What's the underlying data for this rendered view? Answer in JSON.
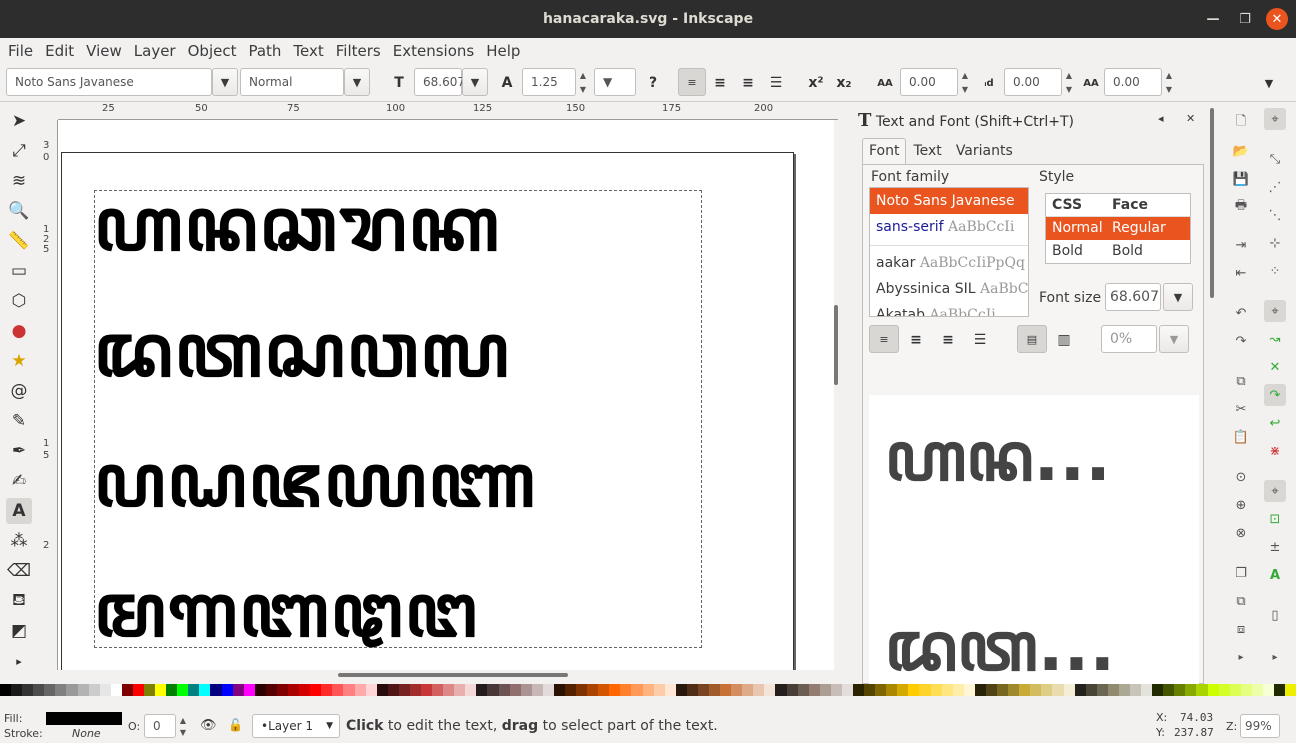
{
  "window": {
    "title": "hanacaraka.svg - Inkscape"
  },
  "menu": [
    "File",
    "Edit",
    "View",
    "Layer",
    "Object",
    "Path",
    "Text",
    "Filters",
    "Extensions",
    "Help"
  ],
  "toolbar": {
    "font_family": "Noto Sans Javanese",
    "font_style": "Normal",
    "font_size": "68.607",
    "line_spacing": "1.25",
    "letter_spacing": "0.00",
    "word_spacing": "0.00",
    "kerning": "0.00",
    "help": "?"
  },
  "ruler": {
    "top_ticks": [
      "25",
      "50",
      "75",
      "100",
      "125",
      "150",
      "175",
      "200"
    ],
    "left_ticks": [
      "3",
      "0",
      "1",
      "2",
      "5",
      "1",
      "5",
      "2"
    ]
  },
  "canvas": {
    "lines": [
      "ꦲꦤꦕꦫꦏ",
      "ꦢꦠꦱꦮꦭ",
      "ꦥꦝꦗꦪꦚ",
      "ꦩꦒꦧꦛꦔ"
    ]
  },
  "dock": {
    "title": "Text and Font (Shift+Ctrl+T)",
    "tabs": [
      "Font",
      "Text",
      "Variants"
    ],
    "font_family_label": "Font family",
    "families": [
      {
        "name": "Noto Sans Javanese",
        "sample": ""
      },
      {
        "name": "sans-serif",
        "sample": "AaBbCcIi"
      },
      {
        "name": "aakar",
        "sample": "AaBbCcIiPpQq"
      },
      {
        "name": "Abyssinica SIL",
        "sample": "AaBbC"
      },
      {
        "name": "Akatab",
        "sample": "AaBbCcIi"
      }
    ],
    "style_label": "Style",
    "style_headers": [
      "CSS",
      "Face"
    ],
    "styles": [
      [
        "Normal",
        "Regular"
      ],
      [
        "Bold",
        "Bold"
      ]
    ],
    "font_size_label": "Font size",
    "font_size": "68.607",
    "spacing_percent": "0%",
    "preview_lines": [
      "ꦲꦤ...",
      "ꦢꦠ..."
    ]
  },
  "status": {
    "fill_label": "Fill:",
    "stroke_label": "Stroke:",
    "stroke_value": "None",
    "opacity_label": "O:",
    "opacity_value": "0",
    "layer": "•Layer 1",
    "message_bold1": "Click",
    "message_1": " to edit the text, ",
    "message_bold2": "drag",
    "message_2": " to select part of the text.",
    "x_label": "X:",
    "x_value": "74.03",
    "y_label": "Y:",
    "y_value": "237.87",
    "z_label": "Z:",
    "zoom": "99%"
  },
  "colors": {
    "accent": "#e9541f",
    "titlebar": "#2d2d2d"
  }
}
